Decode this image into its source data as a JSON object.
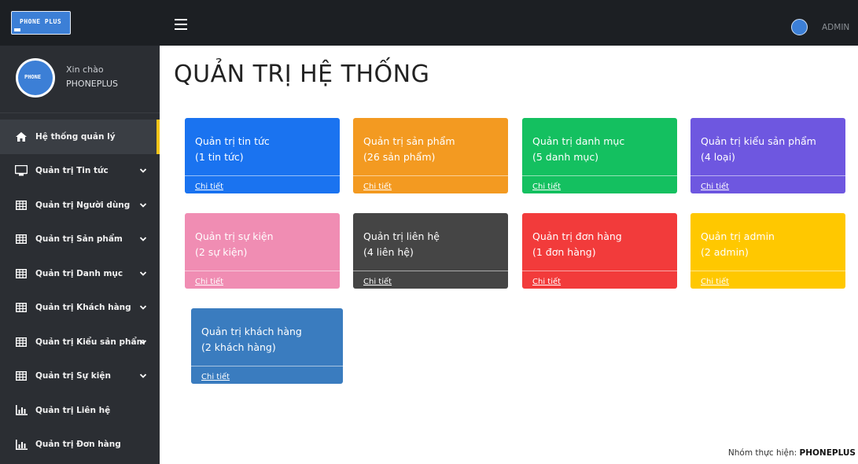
{
  "brand": {
    "logo_text": "PHONE PLUS"
  },
  "user": {
    "greeting": "Xin chào",
    "name": "PHONEPLUS",
    "avatar_text": "PHONE"
  },
  "topbar": {
    "admin_label": "ADMIN"
  },
  "page": {
    "title": "QUẢN TRỊ HỆ THỐNG"
  },
  "sidebar": {
    "items": [
      {
        "label": "Hệ thống quản lý",
        "icon": "home-icon",
        "active": true
      },
      {
        "label": "Quản trị Tin tức",
        "icon": "monitor-icon",
        "expandable": true
      },
      {
        "label": "Quản trị Người dùng",
        "icon": "table-icon",
        "expandable": true
      },
      {
        "label": "Quản trị Sản phẩm",
        "icon": "table-icon",
        "expandable": true
      },
      {
        "label": "Quản trị Danh mục",
        "icon": "table-icon",
        "expandable": true
      },
      {
        "label": "Quản trị Khách hàng",
        "icon": "table-icon",
        "expandable": true
      },
      {
        "label": "Quản trị Kiểu sản phẩm",
        "icon": "table-icon",
        "expandable": true
      },
      {
        "label": "Quản trị Sự kiện",
        "icon": "table-icon",
        "expandable": true
      },
      {
        "label": "Quản trị Liên hệ",
        "icon": "bar-chart-icon"
      },
      {
        "label": "Quản trị Đơn hàng",
        "icon": "bar-chart-icon"
      }
    ]
  },
  "cards": [
    {
      "title": "Quản trị tin tức",
      "count": "(1 tin tức)",
      "link": "Chi tiết",
      "color": "#1a73f0"
    },
    {
      "title": "Quản trị sản phẩm",
      "count": "(26 sản phẩm)",
      "link": "Chi tiết",
      "color": "#f39a21"
    },
    {
      "title": "Quản trị danh mục",
      "count": "(5 danh mục)",
      "link": "Chi tiết",
      "color": "#14c060"
    },
    {
      "title": "Quản trị kiểu sản phẩm",
      "count": "(4 loại)",
      "link": "Chi tiết",
      "color": "#6e57e0"
    },
    {
      "title": "Quản trị sự kiện",
      "count": "(2 sự kiện)",
      "link": "Chi tiết",
      "color": "#f08db3"
    },
    {
      "title": "Quản trị liên hệ",
      "count": "(4 liên hệ)",
      "link": "Chi tiết",
      "color": "#454545"
    },
    {
      "title": "Quản trị đơn hàng",
      "count": "(1 đơn hàng)",
      "link": "Chi tiết",
      "color": "#f23b3b"
    },
    {
      "title": "Quản trị admin",
      "count": "(2 admin)",
      "link": "Chi tiết",
      "color": "#ffc800"
    },
    {
      "title": "Quản trị khách hàng",
      "count": "(2 khách hàng)",
      "link": "Chi tiết",
      "color": "#3a7cbf"
    }
  ],
  "footer": {
    "prefix": "Nhóm thực hiện: ",
    "team": "PHONEPLUS"
  }
}
